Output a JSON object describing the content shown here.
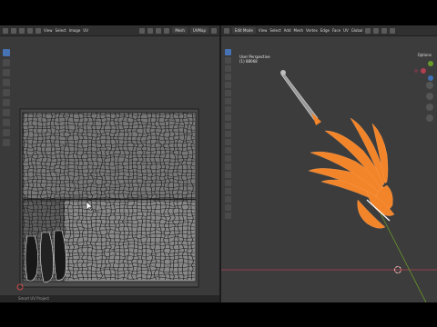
{
  "uv_header": {
    "menus": [
      "View",
      "Select",
      "Image",
      "UV"
    ],
    "mode": "Mesh",
    "uvmap": "UVMap"
  },
  "viewport_header": {
    "mode": "Edit Mode",
    "menus": [
      "View",
      "Select",
      "Add",
      "Mesh",
      "Vertex",
      "Edge",
      "Face",
      "UV"
    ],
    "transform": "Global"
  },
  "viewport_overlay": {
    "view_name": "User Perspective",
    "object_name": "(1) 88068"
  },
  "options_label": "Options",
  "status_bar": {
    "text": "Smart UV Project"
  },
  "colors": {
    "selection": "#f2842a",
    "active_tool": "#4772b3",
    "x_axis": "#b04050",
    "y_axis": "#6a9a2a"
  }
}
